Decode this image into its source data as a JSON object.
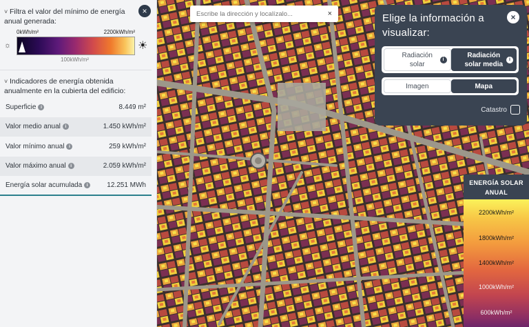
{
  "filter": {
    "title": "Filtra el valor del mínimo de energía anual generada:",
    "min_label": "0kWh/m²",
    "max_label": "2200kWh/m²",
    "mid_label": "100kWh/m²"
  },
  "indicators": {
    "title": "Indicadores de energía obtenida anualmente en la cubierta del edificio:",
    "rows": [
      {
        "label": "Superficie",
        "value": "8.449 m²"
      },
      {
        "label": "Valor medio anual",
        "value": "1.450 kWh/m²"
      },
      {
        "label": "Valor mínimo anual",
        "value": "259 kWh/m²"
      },
      {
        "label": "Valor máximo anual",
        "value": "2.059 kWh/m²"
      },
      {
        "label": "Energía solar acumulada",
        "value": "12.251 MWh"
      }
    ]
  },
  "search": {
    "placeholder": "Escribe la dirección y localízalo..."
  },
  "info_panel": {
    "title": "Elige la información a visualizar:",
    "layer_options": [
      "Radiación solar",
      "Radiación solar media"
    ],
    "view_options": [
      "Imagen",
      "Mapa"
    ],
    "catastro_label": "Catastro"
  },
  "legend": {
    "title": "ENERGÍA SOLAR ANUAL",
    "labels": [
      "2200kWh/m²",
      "1800kWh/m²",
      "1400kWh/m²",
      "1000kWh/m²",
      "600kWh/m²"
    ]
  },
  "icons": {
    "close": "×",
    "info": "i",
    "chevron": "˅",
    "sun_small": "☼",
    "sun_big": "☀"
  }
}
